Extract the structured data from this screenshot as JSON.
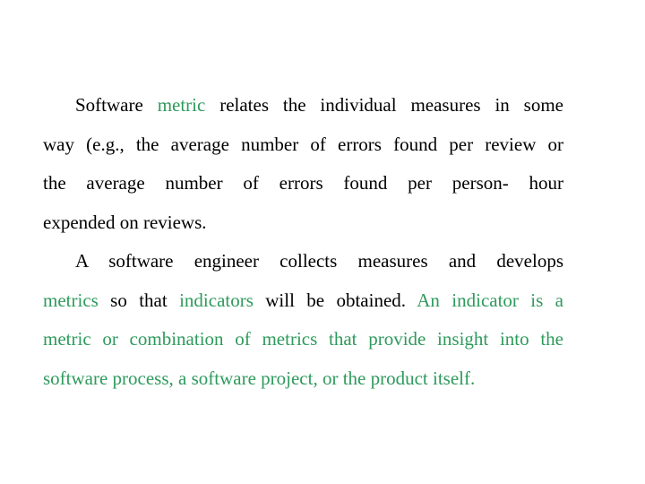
{
  "colors": {
    "text": "#000000",
    "highlight": "#2e9a5c",
    "background": "#ffffff"
  },
  "paragraphs": [
    {
      "lines": [
        [
          {
            "t": "Software ",
            "hl": false
          },
          {
            "t": "metric",
            "hl": true
          },
          {
            "t": " relates the individual measures in some",
            "hl": false
          }
        ],
        [
          {
            "t": "way (e.g., the average number of errors found per review or",
            "hl": false
          }
        ],
        [
          {
            "t": "the average number of errors found per person- hour",
            "hl": false
          }
        ],
        [
          {
            "t": "expended on reviews.",
            "hl": false
          }
        ]
      ]
    },
    {
      "lines": [
        [
          {
            "t": "A software engineer collects measures and develops",
            "hl": false
          }
        ],
        [
          {
            "t": "metrics",
            "hl": true
          },
          {
            "t": " so that ",
            "hl": false
          },
          {
            "t": "indicators",
            "hl": true
          },
          {
            "t": " will be obtained. ",
            "hl": false
          },
          {
            "t": "An indicator is a",
            "hl": true
          }
        ],
        [
          {
            "t": "metric or combination of metrics that provide insight into the",
            "hl": true
          }
        ],
        [
          {
            "t": "software process, a software project, or the product itself.",
            "hl": true
          }
        ]
      ]
    }
  ]
}
